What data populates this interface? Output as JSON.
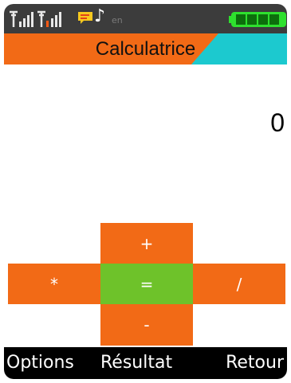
{
  "status_bar": {
    "signal_1": "signal-icon",
    "signal_2": "signal-icon",
    "message_icon": "message-icon",
    "music_icon": "music-note-icon",
    "faint_label": "en",
    "battery_icon": "battery-icon",
    "battery_bars": 4
  },
  "header": {
    "title": "Calculatrice"
  },
  "display": {
    "value": "0"
  },
  "keypad": {
    "plus": "+",
    "multiply": "*",
    "equals": "=",
    "divide": "/",
    "minus": "-"
  },
  "softkeys": {
    "left": "Options",
    "middle": "Résultat",
    "right": "Retour"
  },
  "colors": {
    "accent_orange": "#f26a16",
    "accent_cyan": "#1cc9cf",
    "equals_green": "#6ec22a",
    "battery_green": "#2ee02e"
  }
}
